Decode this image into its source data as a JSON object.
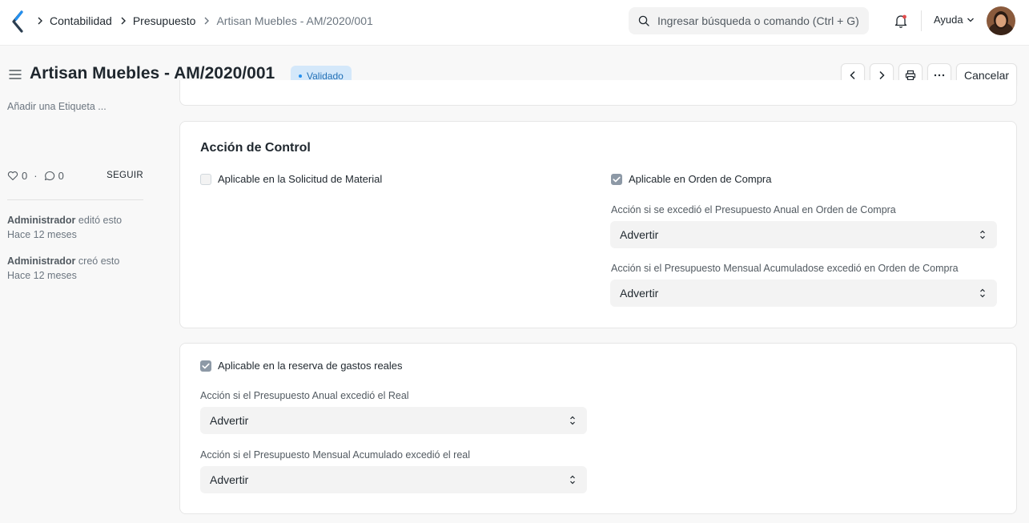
{
  "navbar": {
    "breadcrumbs": [
      {
        "label": "Contabilidad"
      },
      {
        "label": "Presupuesto"
      },
      {
        "label": "Artisan Muebles - AM/2020/001"
      }
    ],
    "search_placeholder": "Ingresar búsqueda o comando (Ctrl + G)",
    "help_label": "Ayuda"
  },
  "header": {
    "title": "Artisan Muebles - AM/2020/001",
    "status": "Validado",
    "cancel_label": "Cancelar"
  },
  "sidebar": {
    "add_tag": "Añadir una Etiqueta ...",
    "likes": "0",
    "comments": "0",
    "follow_label": "SEGUIR",
    "activity": [
      {
        "user": "Administrador",
        "action": "editó esto",
        "time": "Hace 12 meses"
      },
      {
        "user": "Administrador",
        "action": "creó esto",
        "time": "Hace 12 meses"
      }
    ]
  },
  "control_section": {
    "title": "Acción de Control",
    "material_request": {
      "label": "Aplicable en la Solicitud de Material",
      "checked": false
    },
    "purchase_order": {
      "label": "Aplicable en Orden de Compra",
      "checked": true
    },
    "annual_po_label": "Acción si se excedió el Presupuesto Anual en Orden de Compra",
    "annual_po_value": "Advertir",
    "monthly_po_label": "Acción si el Presupuesto Mensual Acumuladose excedió en Orden de Compra",
    "monthly_po_value": "Advertir"
  },
  "actual_section": {
    "actual_expenses": {
      "label": "Aplicable en la reserva de gastos reales",
      "checked": true
    },
    "annual_actual_label": "Acción si el Presupuesto Anual excedió el Real",
    "annual_actual_value": "Advertir",
    "monthly_actual_label": "Acción si el Presupuesto Mensual Acumulado excedió el real",
    "monthly_actual_value": "Advertir"
  },
  "colors": {
    "badge_bg": "#d4e8fa",
    "badge_text": "#1f6fb6",
    "checkbox_on": "#8d99a6"
  }
}
